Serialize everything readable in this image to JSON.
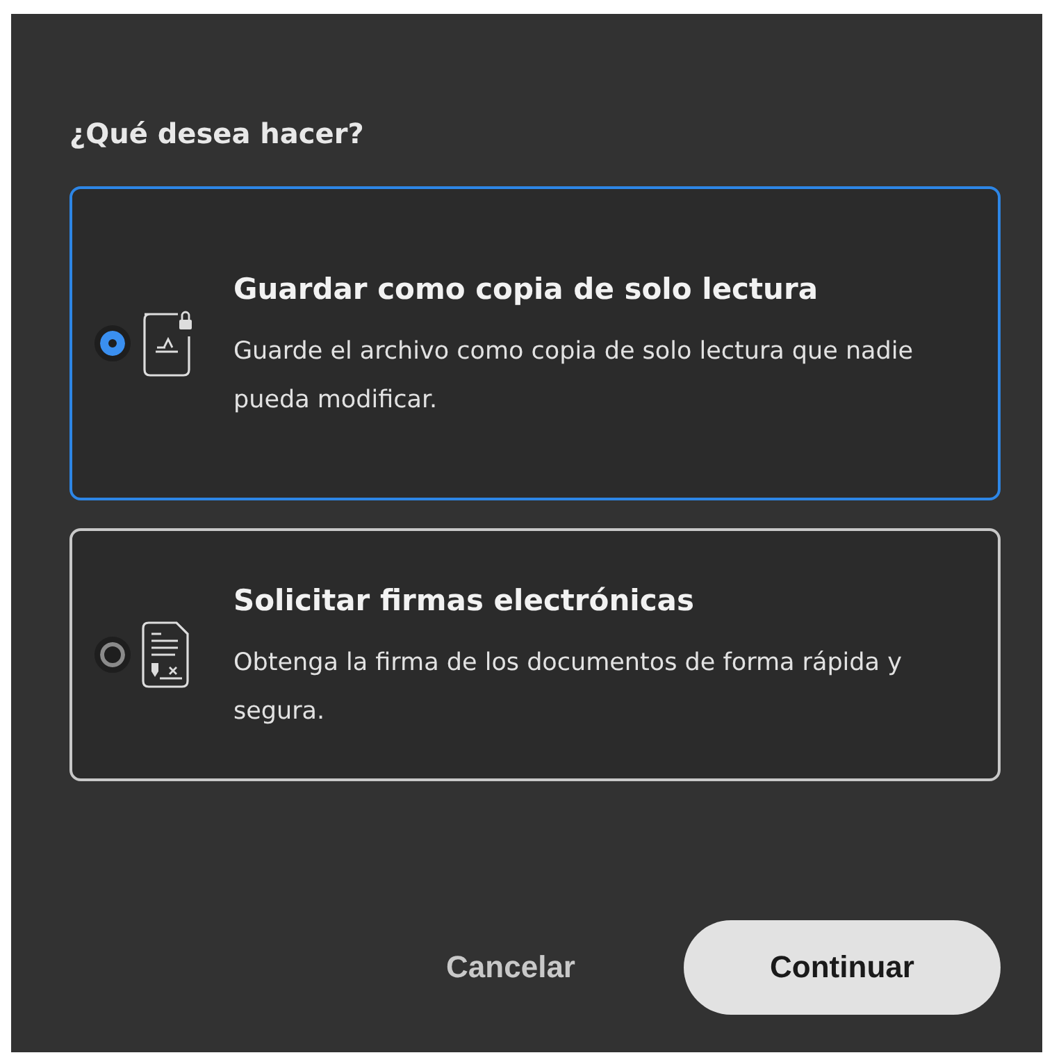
{
  "dialog": {
    "title": "¿Qué desea hacer?",
    "options": [
      {
        "kind": "readonly",
        "title": "Guardar como copia de solo lectura",
        "description": "Guarde el archivo como copia de solo lectura que nadie pueda modificar.",
        "selected": true
      },
      {
        "kind": "signature",
        "title": "Solicitar firmas electrónicas",
        "description": "Obtenga la firma de los documentos de forma rápida y segura.",
        "selected": false
      }
    ],
    "buttons": {
      "cancel": "Cancelar",
      "confirm": "Continuar"
    }
  }
}
